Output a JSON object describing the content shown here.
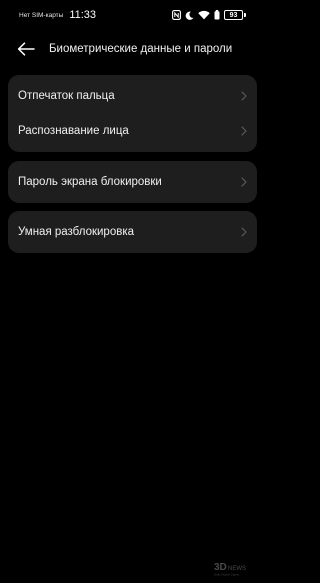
{
  "status_bar": {
    "carrier": "Нет SIM-карты",
    "time": "11:33",
    "battery_level": "93",
    "icons": [
      "nfc-icon",
      "moon-icon",
      "wifi-icon",
      "battery-saver-icon",
      "battery-icon"
    ]
  },
  "header": {
    "title": "Биометрические данные и пароли",
    "back_icon": "arrow-left-icon"
  },
  "groups": [
    {
      "items": [
        {
          "label": "Отпечаток пальца",
          "icon": "chevron-right-icon"
        },
        {
          "label": "Распознавание лица",
          "icon": "chevron-right-icon"
        }
      ]
    },
    {
      "items": [
        {
          "label": "Пароль экрана блокировки",
          "icon": "chevron-right-icon"
        }
      ]
    },
    {
      "items": [
        {
          "label": "Умная разблокировка",
          "icon": "chevron-right-icon"
        }
      ]
    }
  ],
  "watermark": {
    "logo_text": "3DNews",
    "tagline": "Daily Digital Digest"
  },
  "colors": {
    "background": "#000000",
    "card": "#1e1e1e",
    "text": "#f0f0f0",
    "chevron": "#5a5a5a"
  }
}
